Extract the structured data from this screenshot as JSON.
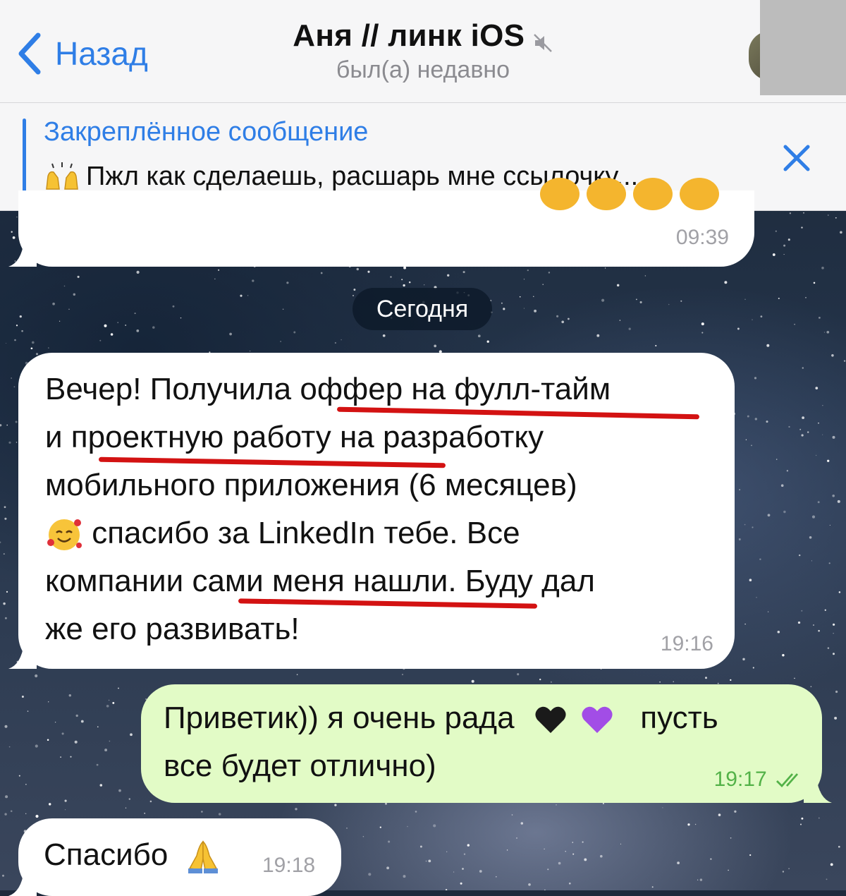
{
  "header": {
    "back_label": "Назад",
    "title": "Аня // линк iOS",
    "status": "был(а) недавно"
  },
  "pinned": {
    "title": "Закреплённое сообщение",
    "text": "Пжл как сделаешь, расшарь мне ссылочку...",
    "emoji": "raising-hands"
  },
  "messages": {
    "previous": {
      "time": "09:39"
    },
    "date_divider": "Сегодня",
    "incoming_1": {
      "line1": "Вечер! Получила оффер на фулл-тайм",
      "line2": "и проектную работу на разработку",
      "line3": "мобильного приложения (6 месяцев)",
      "line4": "спасибо за LinkedIn тебе. Все",
      "line5": "компании сами меня нашли. Буду дал",
      "line6": "же его развивать!",
      "time": "19:16",
      "highlights": [
        "оффер на фулл-тайм",
        "проектную работу на",
        "сами меня нашли."
      ]
    },
    "outgoing_1": {
      "line1_a": "Приветик)) я очень рада",
      "line1_b": "пусть",
      "line2": "все будет отлично)",
      "time": "19:17",
      "status": "read"
    },
    "incoming_2": {
      "text": "Спасибо",
      "time": "19:18"
    }
  },
  "colors": {
    "accent": "#2f7ee6",
    "outgoing_bubble": "#e2fbc6",
    "outgoing_time": "#53b248",
    "underline": "#d31212"
  }
}
